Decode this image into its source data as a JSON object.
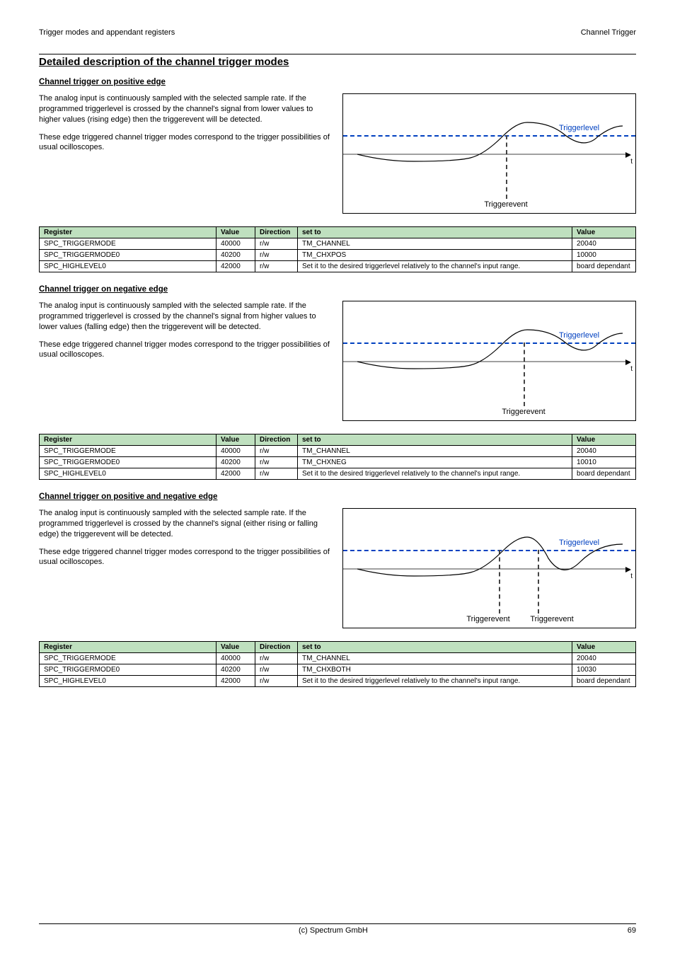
{
  "header": {
    "left": "Trigger modes and appendant registers",
    "right": "Channel Trigger"
  },
  "title": "Detailed description of the channel trigger modes",
  "sections": [
    {
      "subtitle": "Channel trigger on positive edge",
      "para1": "The analog input is continuously sampled with the selected sample rate. If the programmed triggerlevel is crossed by the channel's signal from lower values to higher values (rising edge) then the triggerevent will be detected.",
      "para2": "These edge triggered channel trigger modes correspond to the trigger possibilities of usual ocilloscopes.",
      "diagram": {
        "triggerlevel": "Triggerlevel",
        "t": "t",
        "triggerevents": [
          "Triggerevent"
        ]
      }
    },
    {
      "subtitle": "Channel trigger on negative edge",
      "para1": "The analog input is continuously sampled with the selected sample rate. If the programmed triggerlevel is crossed by the channel's signal from higher values to lower values (falling edge) then the triggerevent will be detected.",
      "para2": "These edge triggered channel trigger modes correspond to the trigger possibilities of usual ocilloscopes.",
      "diagram": {
        "triggerlevel": "Triggerlevel",
        "t": "t",
        "triggerevents": [
          "Triggerevent"
        ]
      }
    },
    {
      "subtitle": "Channel trigger on positive and negative edge",
      "para1": "The analog input is continuously sampled with the selected sample rate. If the programmed triggerlevel is crossed by the channel's signal (either rising or falling edge) the triggerevent will be detected.",
      "para2": "These edge triggered channel trigger modes correspond to the trigger possibilities of usual ocilloscopes.",
      "diagram": {
        "triggerlevel": "Triggerlevel",
        "t": "t",
        "triggerevents": [
          "Triggerevent",
          "Triggerevent"
        ]
      }
    }
  ],
  "table_headers": {
    "register": "Register",
    "value": "Value",
    "direction": "Direction",
    "set_to": "set to",
    "value2": "Value"
  },
  "tables": [
    {
      "rows": [
        {
          "register": "SPC_TRIGGERMODE",
          "value": "40000",
          "direction": "r/w",
          "set_to": "TM_CHANNEL",
          "value2": "20040"
        },
        {
          "register": "SPC_TRIGGERMODE0",
          "value": "40200",
          "direction": "r/w",
          "set_to": "TM_CHXPOS",
          "value2": "10000"
        },
        {
          "register": "SPC_HIGHLEVEL0",
          "value": "42000",
          "direction": "r/w",
          "set_to": "Set it to the desired triggerlevel relatively to the channel's input range.",
          "value2": "board dependant"
        }
      ]
    },
    {
      "rows": [
        {
          "register": "SPC_TRIGGERMODE",
          "value": "40000",
          "direction": "r/w",
          "set_to": "TM_CHANNEL",
          "value2": "20040"
        },
        {
          "register": "SPC_TRIGGERMODE0",
          "value": "40200",
          "direction": "r/w",
          "set_to": "TM_CHXNEG",
          "value2": "10010"
        },
        {
          "register": "SPC_HIGHLEVEL0",
          "value": "42000",
          "direction": "r/w",
          "set_to": "Set it to the desired triggerlevel relatively to the channel's input range.",
          "value2": "board dependant"
        }
      ]
    },
    {
      "rows": [
        {
          "register": "SPC_TRIGGERMODE",
          "value": "40000",
          "direction": "r/w",
          "set_to": "TM_CHANNEL",
          "value2": "20040"
        },
        {
          "register": "SPC_TRIGGERMODE0",
          "value": "40200",
          "direction": "r/w",
          "set_to": "TM_CHXBOTH",
          "value2": "10030"
        },
        {
          "register": "SPC_HIGHLEVEL0",
          "value": "42000",
          "direction": "r/w",
          "set_to": "Set it to the desired triggerlevel relatively to the channel's input range.",
          "value2": "board dependant"
        }
      ]
    }
  ],
  "footer": {
    "center": "(c) Spectrum GmbH",
    "right": "69"
  },
  "chart_data": [
    {
      "type": "line",
      "title": "Channel trigger on positive edge",
      "trigger_level_y": 0.6,
      "events_x": [
        0.55
      ],
      "description": "Waveform crosses Triggerlevel from below at x≈0.55",
      "xlabel": "t",
      "annotations": [
        "Triggerlevel",
        "Triggerevent"
      ]
    },
    {
      "type": "line",
      "title": "Channel trigger on negative edge",
      "trigger_level_y": 0.6,
      "events_x": [
        0.62
      ],
      "description": "Waveform crosses Triggerlevel from above at x≈0.62",
      "xlabel": "t",
      "annotations": [
        "Triggerlevel",
        "Triggerevent"
      ]
    },
    {
      "type": "line",
      "title": "Channel trigger on positive and negative edge",
      "trigger_level_y": 0.6,
      "events_x": [
        0.53,
        0.66
      ],
      "description": "Waveform crosses Triggerlevel rising at x≈0.53 and falling at x≈0.66",
      "xlabel": "t",
      "annotations": [
        "Triggerlevel",
        "Triggerevent",
        "Triggerevent"
      ]
    }
  ]
}
